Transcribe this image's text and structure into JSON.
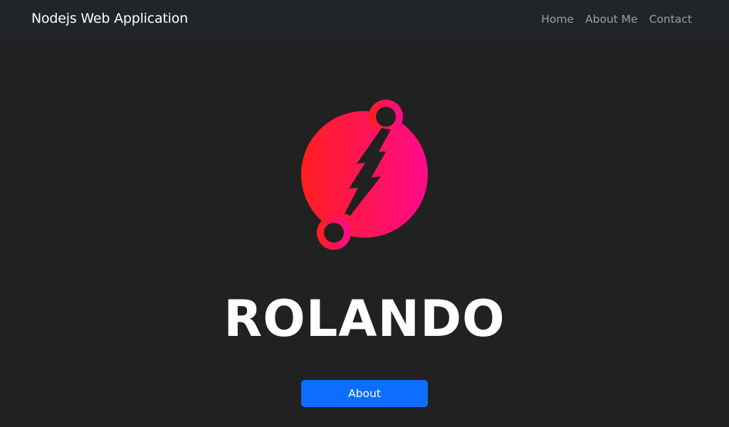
{
  "navbar": {
    "brand": "Nodejs Web Application",
    "links": [
      {
        "label": "Home"
      },
      {
        "label": "About Me"
      },
      {
        "label": "Contact"
      }
    ]
  },
  "hero": {
    "logo_icon": "lightning-circle-logo-icon",
    "title": "ROLANDO",
    "button_label": "About"
  },
  "colors": {
    "page_background": "#212121",
    "navbar_background": "#212529",
    "logo_gradient_start": "#ff1f1f",
    "logo_gradient_end": "#ff0a8a",
    "button": "#0d6efd"
  }
}
